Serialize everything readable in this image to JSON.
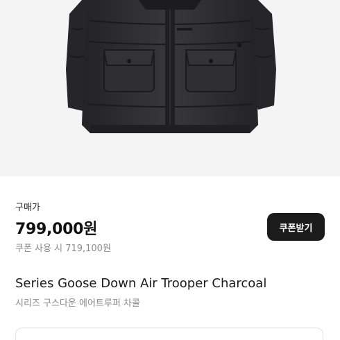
{
  "product": {
    "image_alt": "charcoal goose down parka",
    "price_label": "구매가",
    "price": "799,000원",
    "coupon_price": "쿠폰 사용 시 719,100원",
    "coupon_button": "쿠폰받기",
    "name_en": "Series Goose Down Air Trooper Charcoal",
    "name_ko": "시리즈 구스다운 에어트루퍼 차콜"
  },
  "colors": {
    "image_background": "#f4f4f4",
    "jacket": "#2b2b2d",
    "button_background": "#1b1b1b",
    "secondary_text": "#8a8a8a"
  }
}
